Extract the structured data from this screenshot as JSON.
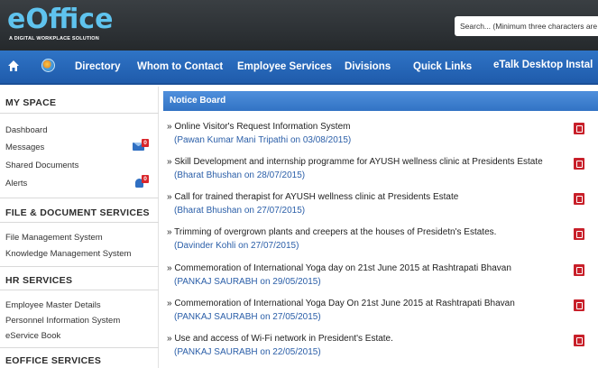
{
  "header": {
    "logo_text": "eOffice",
    "tagline": "A DIGITAL WORKPLACE SOLUTION",
    "search_placeholder": "Search... (Minimum three characters are r"
  },
  "nav": {
    "items": [
      "Directory",
      "Whom to Contact",
      "Employee Services",
      "Divisions",
      "Quick Links"
    ],
    "etalk_label": "eTalk Desktop Installer",
    "home_icon": "home-icon",
    "globe_icon": "globe-icon"
  },
  "sidebar": {
    "my_space": {
      "heading": "MY SPACE",
      "links": [
        "Dashboard",
        "Messages",
        "Shared Documents",
        "Alerts"
      ],
      "messages_badge": "0",
      "alerts_badge": "0"
    },
    "file_document": {
      "heading": "FILE & DOCUMENT SERVICES",
      "links": [
        "File Management System",
        "Knowledge Management System"
      ]
    },
    "hr": {
      "heading": "HR SERVICES",
      "links": [
        "Employee Master Details",
        "Personnel Information System",
        "eService Book"
      ]
    },
    "eoffice": {
      "heading": "EOFFICE SERVICES"
    }
  },
  "notice_board": {
    "title": "Notice Board",
    "notices": [
      {
        "title": "» Online Visitor's Request Information System",
        "meta": "(Pawan Kumar Mani Tripathi on 03/08/2015)"
      },
      {
        "title": "» Skill Development and internship programme for AYUSH wellness clinic at Presidents Estate",
        "meta": "(Bharat Bhushan on 28/07/2015)"
      },
      {
        "title": "» Call for trained therapist for AYUSH wellness clinic at Presidents Estate",
        "meta": "(Bharat Bhushan on 27/07/2015)"
      },
      {
        "title": "» Trimming of overgrown plants and creepers at the houses of Presidetn's Estates.",
        "meta": "(Davinder Kohli on 27/07/2015)"
      },
      {
        "title": "» Commemoration of International Yoga day on 21st June 2015 at Rashtrapati Bhavan",
        "meta": "(PANKAJ SAURABH on 29/05/2015)"
      },
      {
        "title": "» Commemoration of International Yoga Day On 21st June 2015 at Rashtrapati Bhavan",
        "meta": "(PANKAJ SAURABH on 27/05/2015)"
      },
      {
        "title": "» Use and access of Wi-Fi network in President's Estate.",
        "meta": "(PANKAJ SAURABH on 22/05/2015)"
      }
    ]
  },
  "colors": {
    "nav_blue": "#2467b8",
    "header_dark": "#2e3336",
    "logo_cyan": "#5fc3ee",
    "link_blue": "#2a5ea8",
    "badge_red": "#d9262b"
  }
}
